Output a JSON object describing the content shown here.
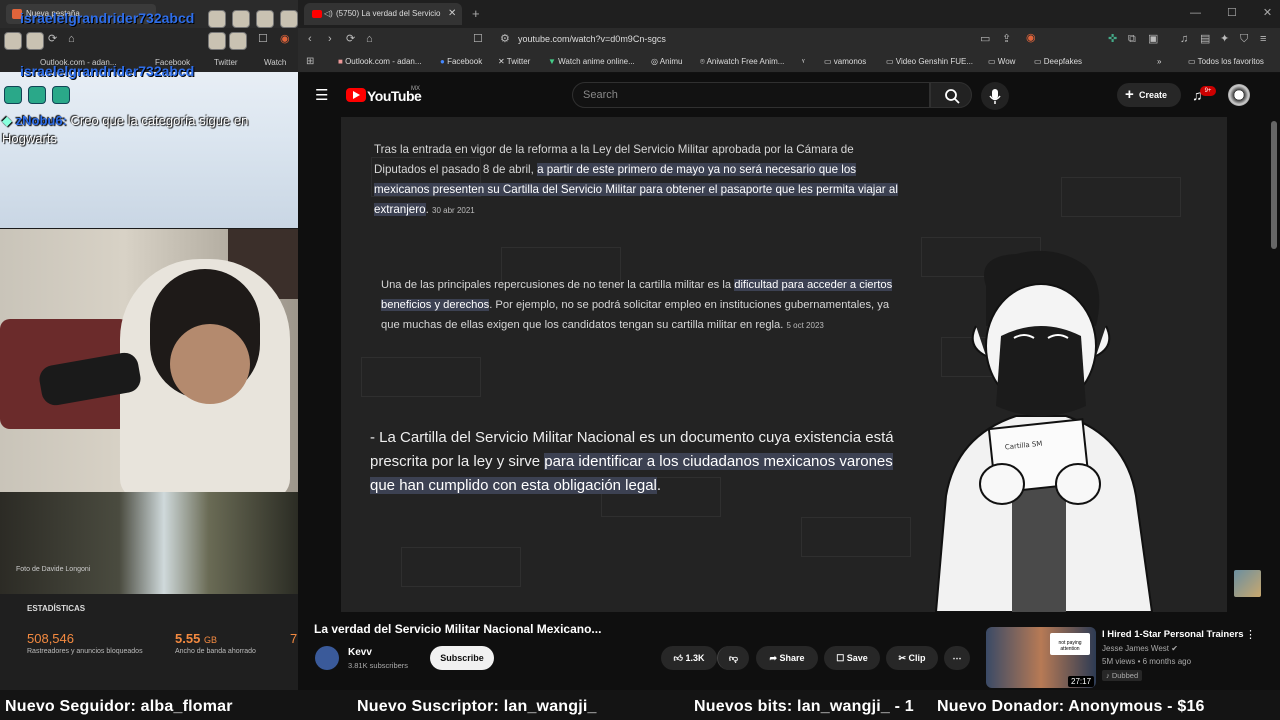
{
  "overlay": {
    "left_tab_label": "Nueva pestaña",
    "chat_username_1": "israelelgrandrider732abcd",
    "chat_username_2": "israelelgrandrider732abcd",
    "left_bookmarks": [
      "Outlook.com - adan...",
      "Facebook",
      "Twitter",
      "Watch"
    ],
    "chat_message_user": "zNobu6:",
    "chat_message_text": "Creo que la categoría sigue en Hogwarts",
    "photo_credit": "Foto de Davide Longoni",
    "stats_title": "ESTADÍSTICAS",
    "stat_trackers_value": "508,546",
    "stat_trackers_label": "Rastreadores y anuncios bloqueados",
    "stat_bandwidth_value": "5.55",
    "stat_bandwidth_unit": "GB",
    "stat_bandwidth_label": "Ancho de banda ahorrado",
    "stat_third_value": "7"
  },
  "browser": {
    "tab_title": "(5750) La verdad del Servicio",
    "url": "youtube.com/watch?v=d0m9Cn-sgcs",
    "bookmarks": [
      "Outlook.com - adan...",
      "Facebook",
      "Twitter",
      "Watch anime online...",
      "Animu",
      "Aniwatch Free Anim...",
      "vamonos",
      "Video Genshin FUE...",
      "Wow",
      "Deepfakes"
    ],
    "all_bookmarks": "Todos los favoritos"
  },
  "youtube": {
    "logo_text": "YouTube",
    "logo_region": "MX",
    "search_placeholder": "Search",
    "create_label": "Create",
    "notification_count": "9+"
  },
  "video": {
    "text1_plain": "Tras la entrada en vigor de la reforma a la Ley del Servicio Militar aprobada por la Cámara de Diputados el pasado 8 de abril, ",
    "text1_highlight": "a partir de este primero de mayo ya no será necesario que los mexicanos presenten su Cartilla del Servicio Militar para obtener el pasaporte que les permita viajar al extranjero",
    "text1_end": ".",
    "text1_date": "30 abr 2021",
    "text2_plain": "Una de las principales repercusiones de no tener la cartilla militar es la ",
    "text2_highlight": "dificultad para acceder a ciertos beneficios y derechos",
    "text2_end": ". Por ejemplo, no se podrá solicitar empleo en instituciones gubernamentales, ya que muchas de ellas exigen que los candidatos tengan su cartilla militar en regla.",
    "text2_date": "5 oct 2023",
    "text3_plain": "- La Cartilla del Servicio Militar Nacional es un documento cuya existencia está prescrita por la ley y sirve ",
    "text3_highlight": "para identificar a los ciudadanos mexicanos varones que han cumplido con esta obligación legal",
    "text3_end": ".",
    "paper_text": "Cartilla SM",
    "title": "La verdad del Servicio Militar Nacional Mexicano...",
    "channel_name": "Kevv",
    "channel_subs": "3.81K subscribers",
    "subscribe_label": "Subscribe",
    "like_count": "1.3K",
    "share_label": "Share",
    "save_label": "Save",
    "clip_label": "Clip"
  },
  "recommendation": {
    "title": "I Hired 1-Star Personal Trainers",
    "channel": "Jesse James West",
    "meta": "5M views • 6 months ago",
    "badge": "Dubbed",
    "duration": "27:17",
    "thumb_sign": "not paying attention"
  },
  "alerts": {
    "follower": "Nuevo Seguidor: alba_flomar",
    "subscriber": "Nuevo Suscriptor: lan_wangji_",
    "bits": "Nuevos bits: lan_wangji_ - 1",
    "donor": "Nuevo Donador: Anonymous - $16"
  }
}
